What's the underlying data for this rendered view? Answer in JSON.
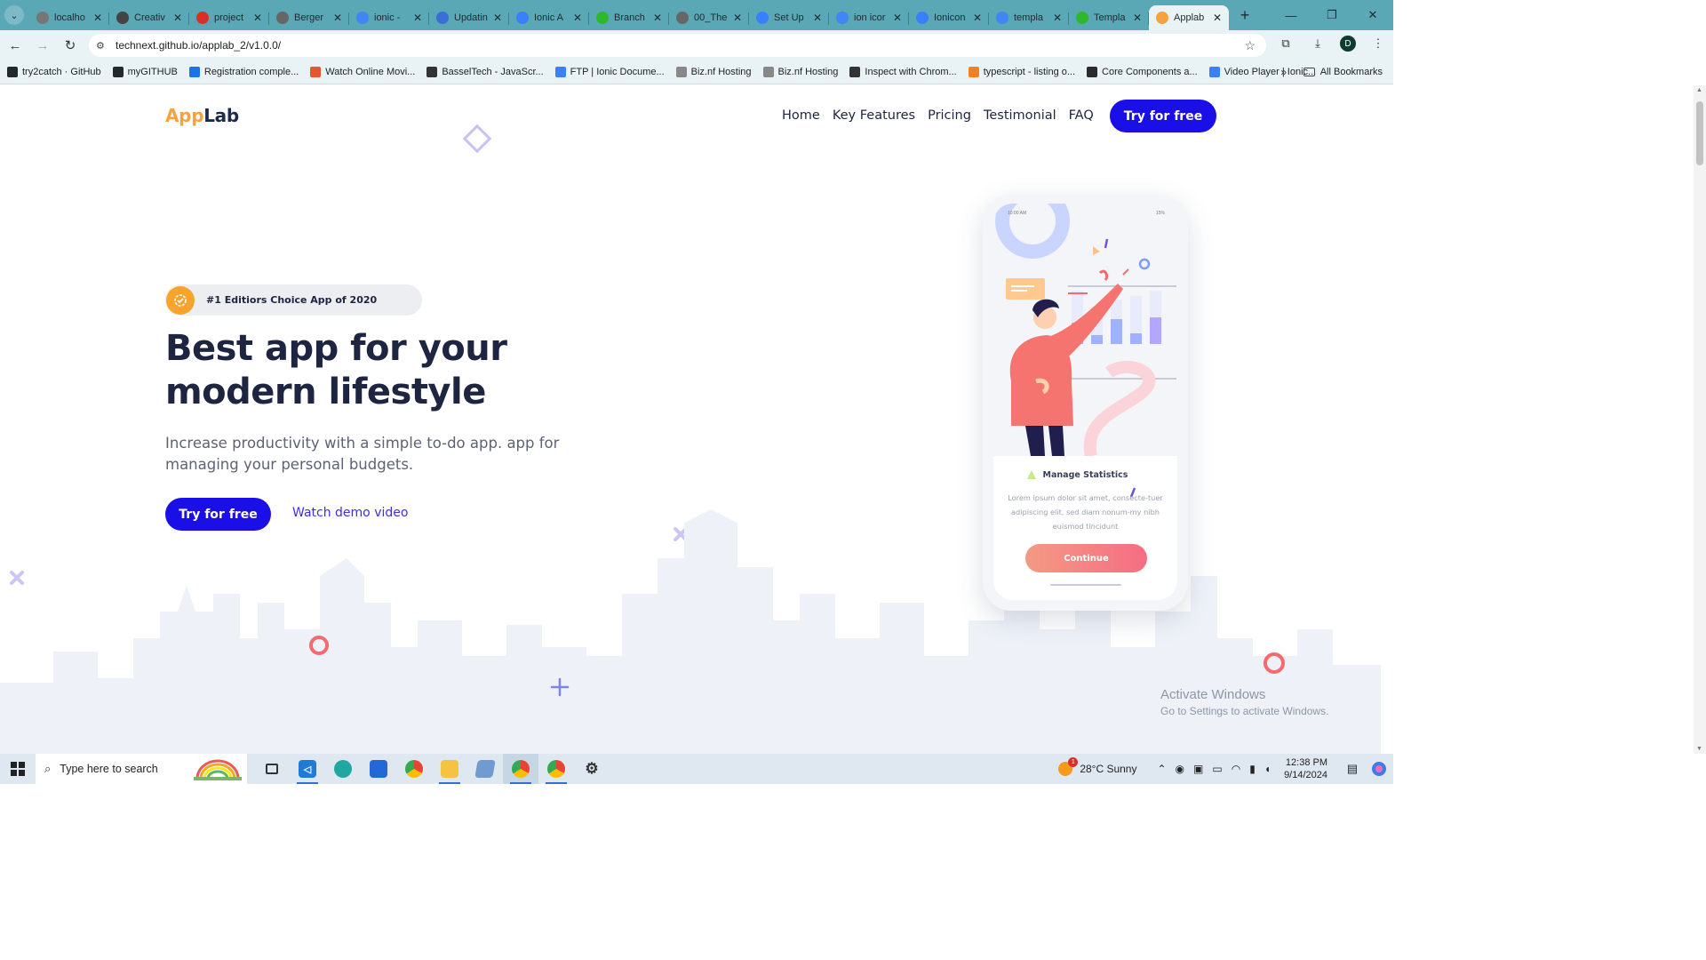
{
  "browser": {
    "tabs": [
      {
        "title": "localho",
        "favicon_color": "#777777"
      },
      {
        "title": "Creativ",
        "favicon_color": "#444444"
      },
      {
        "title": "project",
        "favicon_color": "#d93025"
      },
      {
        "title": "Berger",
        "favicon_color": "#666666"
      },
      {
        "title": "ionic -",
        "favicon_color": "#4285f4"
      },
      {
        "title": "Updatin",
        "favicon_color": "#3b6fd6"
      },
      {
        "title": "Ionic A",
        "favicon_color": "#3880ff"
      },
      {
        "title": "Branch",
        "favicon_color": "#2eb82e"
      },
      {
        "title": "00_The",
        "favicon_color": "#666666"
      },
      {
        "title": "Set Up",
        "favicon_color": "#3880ff"
      },
      {
        "title": "ion icor",
        "favicon_color": "#4285f4"
      },
      {
        "title": "Ionicon",
        "favicon_color": "#3880ff"
      },
      {
        "title": "templa",
        "favicon_color": "#4285f4"
      },
      {
        "title": "Templa",
        "favicon_color": "#2eb82e"
      },
      {
        "title": "Applab",
        "favicon_color": "#f8a13f",
        "active": true
      }
    ],
    "url": "technext.github.io/applab_2/v1.0.0/",
    "profile_initial": "D",
    "bookmarks": [
      {
        "label": "try2catch · GitHub",
        "color": "#24292f"
      },
      {
        "label": "myGITHUB",
        "color": "#24292f"
      },
      {
        "label": "Registration comple...",
        "color": "#1a73e8"
      },
      {
        "label": "Watch Online Movi...",
        "color": "#e4572e"
      },
      {
        "label": "BasselTech - JavaScr...",
        "color": "#333333"
      },
      {
        "label": "FTP | Ionic Docume...",
        "color": "#3880ff"
      },
      {
        "label": "Biz.nf Hosting",
        "color": "#888888"
      },
      {
        "label": "Biz.nf Hosting",
        "color": "#888888"
      },
      {
        "label": "Inspect with Chrom...",
        "color": "#333333"
      },
      {
        "label": "typescript - listing o...",
        "color": "#f48024"
      },
      {
        "label": "Core Components a...",
        "color": "#2b2b2b"
      },
      {
        "label": "Video Player | Ionic...",
        "color": "#3880ff"
      }
    ],
    "all_bookmarks": "All Bookmarks"
  },
  "site": {
    "logo_part1": "App",
    "logo_part2": "Lab",
    "nav": [
      "Home",
      "Key Features",
      "Pricing",
      "Testimonial",
      "FAQ"
    ],
    "nav_cta": "Try for free",
    "badge": "#1 Editiors Choice App of 2020",
    "hero_title": "Best app for your modern lifestyle",
    "hero_subtitle": "Increase productivity with a simple to-do app. app for managing your personal budgets.",
    "hero_cta": "Try for free",
    "demo_link": "Watch demo video",
    "phone": {
      "status_time": "10:00 AM",
      "status_battery": "15%",
      "card_title": "Manage Statistics",
      "card_body": "Lorem ipsum dolor sit amet, consecte-tuer adipiscing elit, sed diam nonum-my nibh euismod tincidunt",
      "continue": "Continue"
    },
    "colors": {
      "primary": "#1a0fe6",
      "accent": "#f8a13f",
      "heading": "#1e2540"
    }
  },
  "watermark": {
    "line1": "Activate Windows",
    "line2": "Go to Settings to activate Windows."
  },
  "taskbar": {
    "search_placeholder": "Type here to search",
    "weather": "28°C  Sunny",
    "weather_badge": "1",
    "time": "12:38 PM",
    "date": "9/14/2024",
    "notifications": "1"
  }
}
